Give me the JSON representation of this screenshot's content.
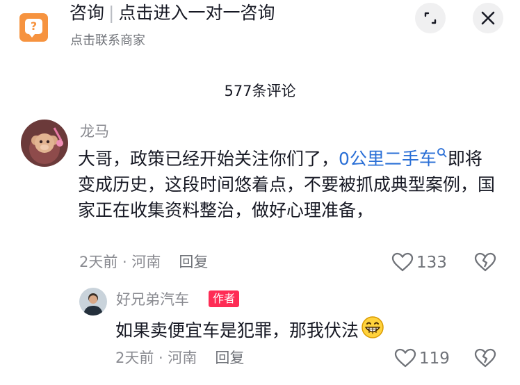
{
  "banner": {
    "title_main": "咨询",
    "separator": "|",
    "title_sub": "点击进入一对一咨询",
    "subtitle": "点击联系商家",
    "icon": "consult-chat-icon",
    "expand_icon": "minimize-expand-icon",
    "close_icon": "close-icon",
    "accent_color": "#f6933f"
  },
  "comments_header": {
    "count_label": "577条评论"
  },
  "comments": [
    {
      "user": "龙马",
      "text_before": "大哥，政策已经开始关注你们了，",
      "search_link": "0公里二手车",
      "text_after": "即将变成历史，这段时间悠着点，不要被抓成典型案例，国家正在收集资料整治，做好心理准备，",
      "time_location": "2天前 · 河南",
      "reply_label": "回复",
      "likes": "133",
      "avatar_icon": "monkey-avatar"
    },
    {
      "user": "好兄弟汽车",
      "badge": "作者",
      "text": "如果卖便宜车是犯罪，那我伏法",
      "emoji": "grin-emoji",
      "time_location": "2天前 · 河南",
      "reply_label": "回复",
      "likes": "119",
      "avatar_icon": "person-avatar"
    }
  ],
  "colors": {
    "link": "#2a6fd6",
    "badge": "#fe2c55",
    "muted": "#8a8b91"
  }
}
